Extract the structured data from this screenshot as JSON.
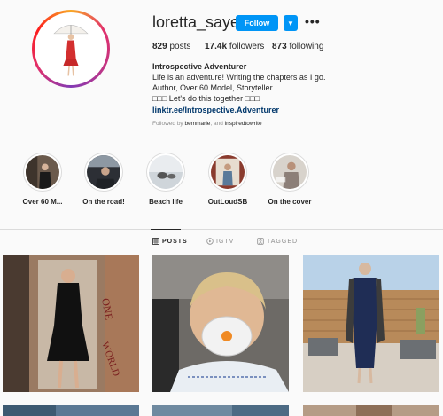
{
  "profile": {
    "username": "loretta_sayers",
    "follow_label": "Follow",
    "stats": {
      "posts_count": "829",
      "posts_label": "posts",
      "followers_count": "17.4k",
      "followers_label": "followers",
      "following_count": "873",
      "following_label": "following"
    },
    "bio": {
      "name": "Introspective Adventurer",
      "line1": "Life is an adventure! Writing the chapters as I go.",
      "line2": "Author, Over 60 Model, Storyteller.",
      "line3": "□□□ Let's do this together □□□",
      "link": "linktr.ee/Introspective.Adventurer",
      "followed_prefix": "Followed by",
      "followed_user1": "bemmarie",
      "followed_sep": ", and",
      "followed_user2": "inspiredtowrite"
    }
  },
  "highlights": [
    {
      "label": "Over 60 M..."
    },
    {
      "label": "On the road!"
    },
    {
      "label": "Beach life"
    },
    {
      "label": "OutLoudSB"
    },
    {
      "label": "On the cover"
    }
  ],
  "tabs": [
    {
      "label": "POSTS",
      "icon": "grid-icon"
    },
    {
      "label": "IGTV",
      "icon": "igtv-icon"
    },
    {
      "label": "TAGGED",
      "icon": "tagged-icon"
    }
  ],
  "colors": {
    "accent": "#0095f6",
    "link": "#00376b",
    "muted": "#8e8e8e"
  }
}
